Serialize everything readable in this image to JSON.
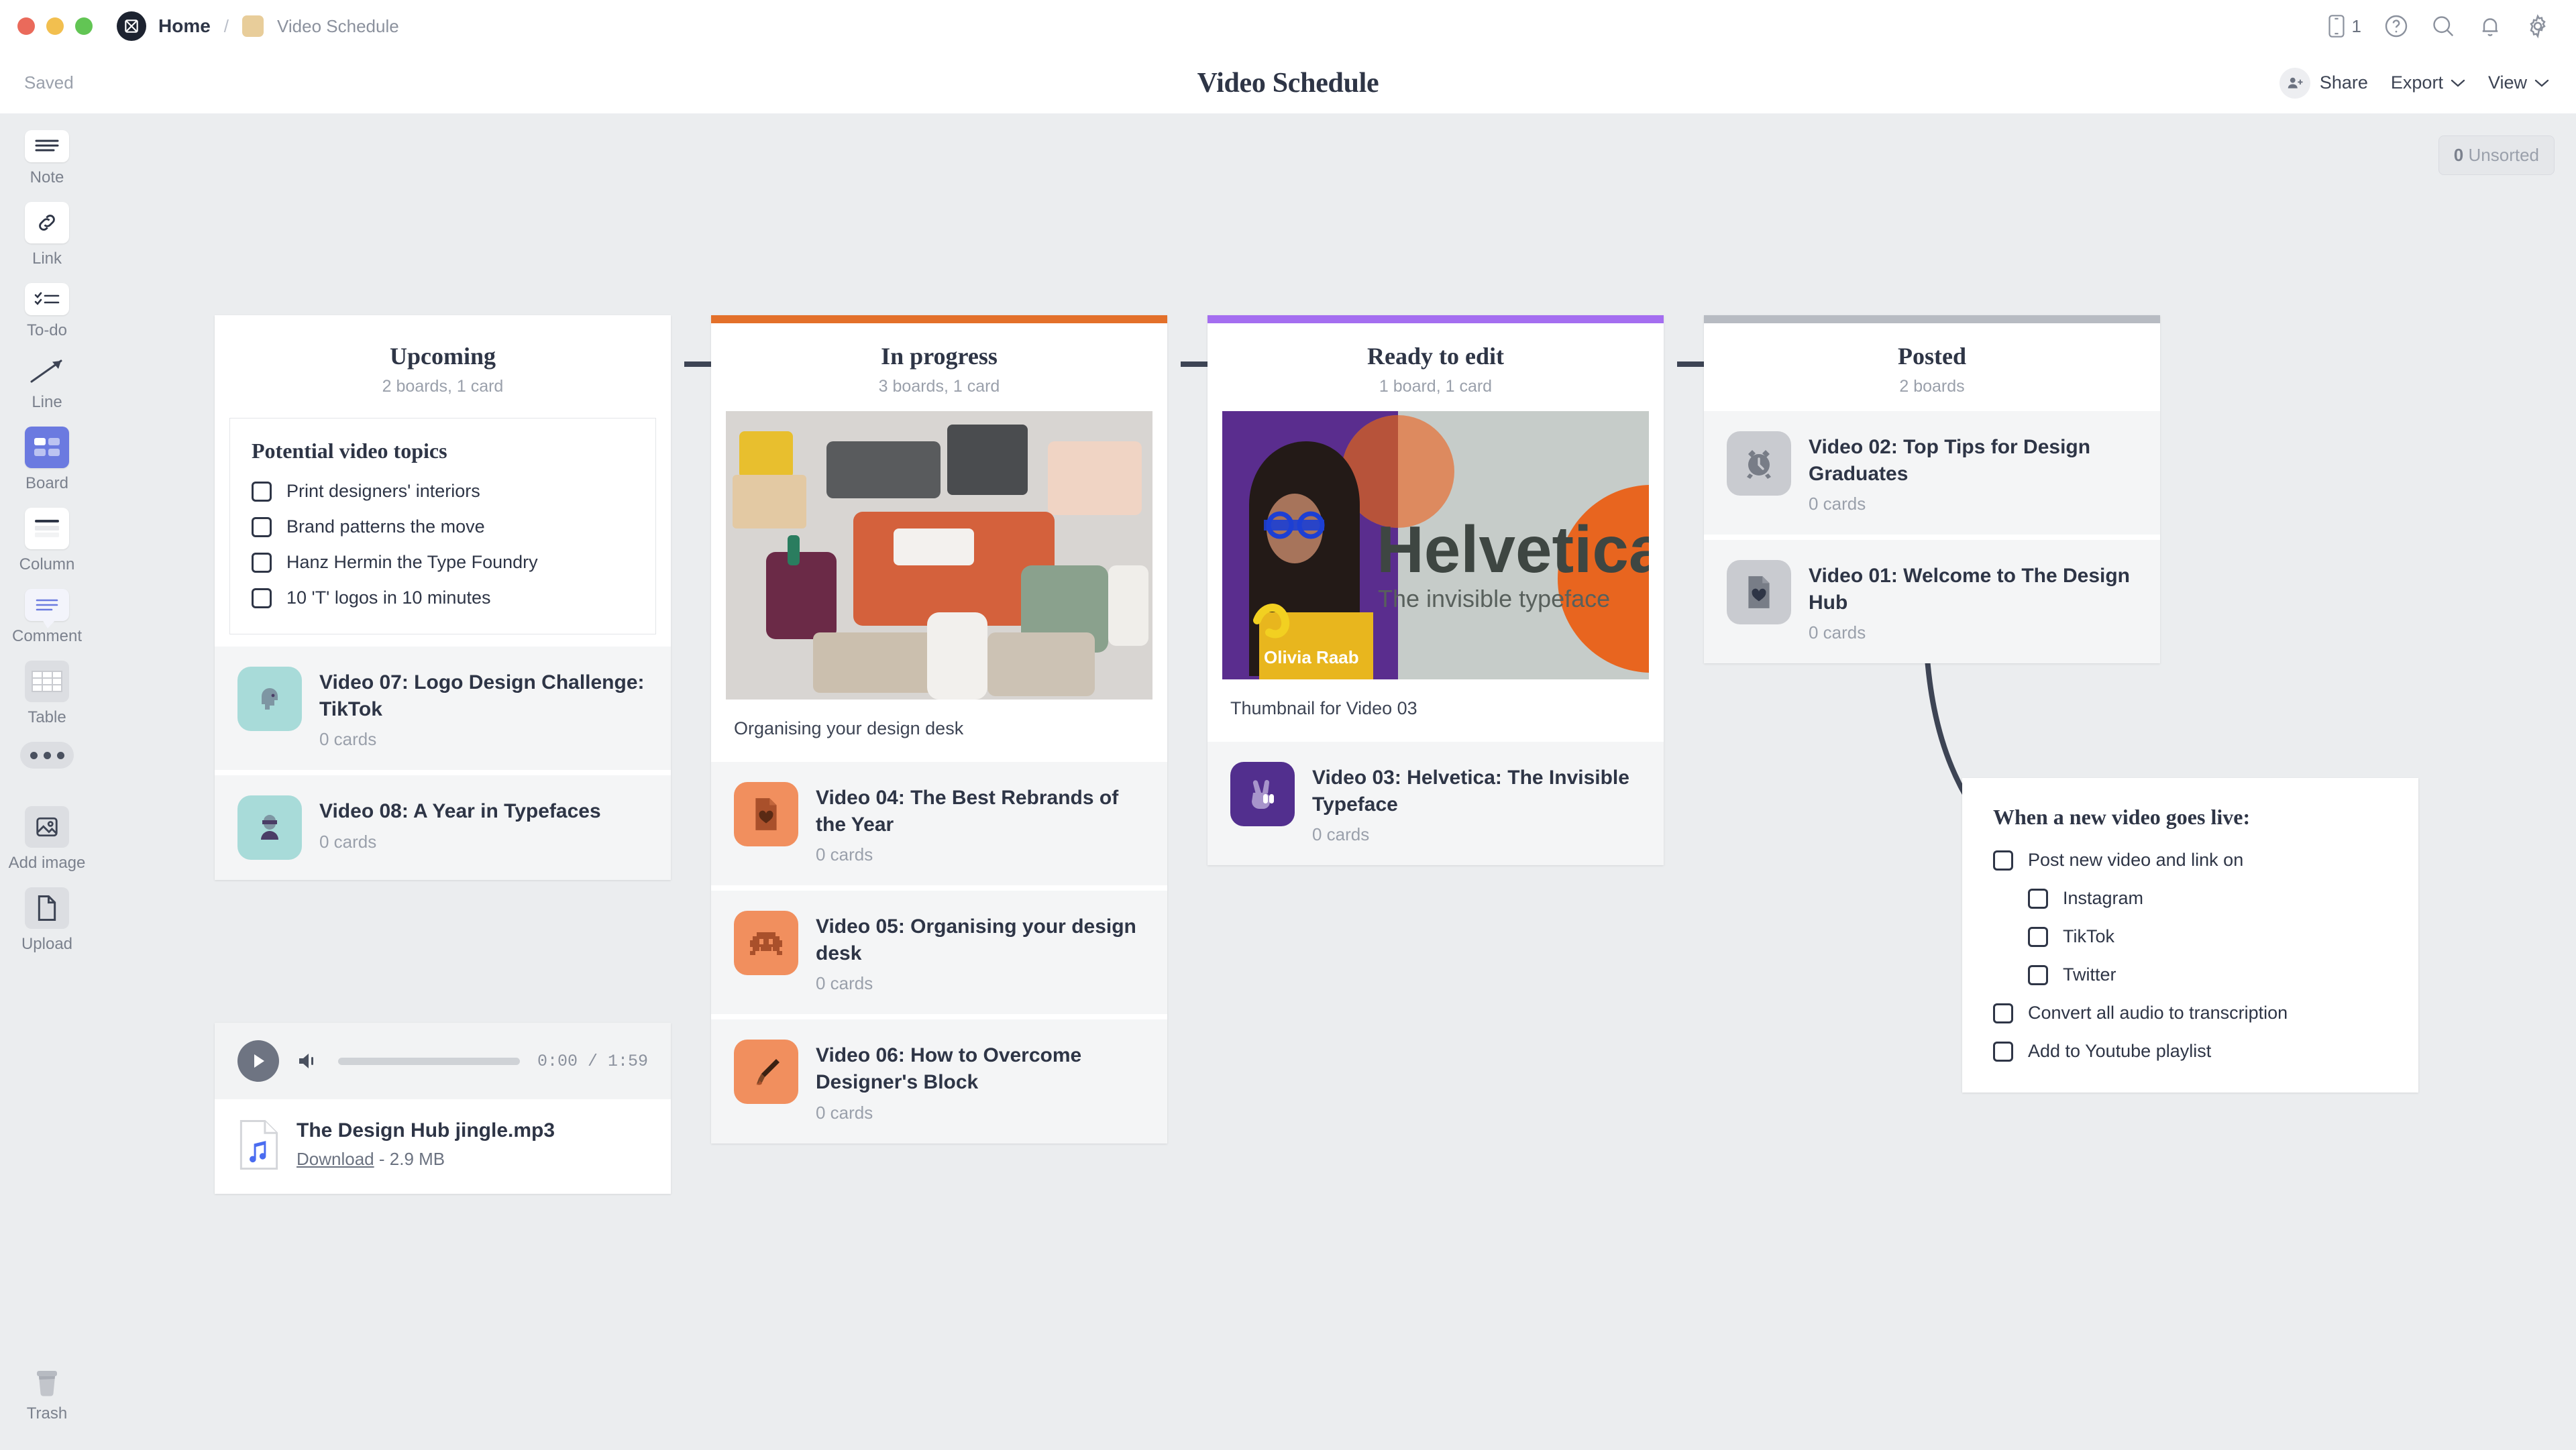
{
  "titlebar": {
    "breadcrumb_home": "Home",
    "breadcrumb_sep": "/",
    "breadcrumb_current": "Video Schedule",
    "mobile_count": "1",
    "icons": [
      "mobile-icon",
      "help-icon",
      "search-icon",
      "bell-icon",
      "gear-icon"
    ]
  },
  "header": {
    "saved_label": "Saved",
    "title": "Video Schedule",
    "share_label": "Share",
    "export_label": "Export",
    "view_label": "View",
    "chevron": "⌄"
  },
  "sidebar": {
    "items": [
      {
        "label": "Note",
        "icon": "note-icon"
      },
      {
        "label": "Link",
        "icon": "link-icon"
      },
      {
        "label": "To-do",
        "icon": "todo-icon"
      },
      {
        "label": "Line",
        "icon": "line-icon"
      },
      {
        "label": "Board",
        "icon": "board-icon"
      },
      {
        "label": "Column",
        "icon": "column-icon"
      },
      {
        "label": "Comment",
        "icon": "comment-icon"
      },
      {
        "label": "Table",
        "icon": "table-icon"
      }
    ],
    "more_label": "more-options",
    "add_image": {
      "label": "Add image",
      "icon": "image-icon"
    },
    "upload": {
      "label": "Upload",
      "icon": "document-icon"
    },
    "trash": {
      "label": "Trash",
      "icon": "trash-icon"
    }
  },
  "canvas": {
    "unsorted_count": "0",
    "unsorted_label": "Unsorted"
  },
  "colors": {
    "accent_orange": "#e3702a",
    "accent_purple": "#a46ef0",
    "accent_grey": "#b7bbc2",
    "board_active": "#6b7ae0"
  },
  "columns": [
    {
      "name": "upcoming",
      "title": "Upcoming",
      "subtitle": "2 boards, 1 card",
      "topbar_color": "transparent",
      "note": {
        "heading": "Potential video topics",
        "items": [
          "Print designers' interiors",
          "Brand patterns the move",
          "Hanz Hermin the Type Foundry",
          "10 'T' logos in 10 minutes"
        ]
      },
      "cards": [
        {
          "title": "Video 07: Logo Design Challenge: TikTok",
          "sub": "0 cards",
          "icon": "head-icon",
          "bg": "#a8dbd9",
          "fg": "#7e96a3"
        },
        {
          "title": "Video 08: A Year in Typefaces",
          "sub": "0 cards",
          "icon": "person-icon",
          "bg": "#a8dbd9",
          "fg": "#4a3d66"
        }
      ]
    },
    {
      "name": "in-progress",
      "title": "In progress",
      "subtitle": "3 boards, 1 card",
      "topbar_color": "#e3702a",
      "image_caption": "Organising your design desk",
      "cards": [
        {
          "title": "Video 04: The Best Rebrands of the Year",
          "sub": "0 cards",
          "icon": "heart-file-icon",
          "bg": "#f18f5e",
          "fg": "#a9502b"
        },
        {
          "title": "Video 05: Organising your design desk",
          "sub": "0 cards",
          "icon": "alien-icon",
          "bg": "#f18f5e",
          "fg": "#a9502b"
        },
        {
          "title": "Video 06: How to Overcome Designer's Block",
          "sub": "0 cards",
          "icon": "brush-icon",
          "bg": "#f18f5e",
          "fg": "#5a2a14"
        }
      ]
    },
    {
      "name": "ready-to-edit",
      "title": "Ready to edit",
      "subtitle": "1 board, 1 card",
      "topbar_color": "#a46ef0",
      "image_caption": "Thumbnail for Video 03",
      "thumbnail": {
        "headline": "Helvetica",
        "subhead": "The invisible typeface",
        "credit": "Olivia Raab"
      },
      "cards": [
        {
          "title": "Video 03: Helvetica: The Invisible Typeface",
          "sub": "0 cards",
          "icon": "peace-hand-icon",
          "bg": "#522f8e",
          "fg": "#a794cb"
        }
      ]
    },
    {
      "name": "posted",
      "title": "Posted",
      "subtitle": "2 boards",
      "topbar_color": "#b7bbc2",
      "cards": [
        {
          "title": "Video 02: Top Tips for Design Graduates",
          "sub": "0 cards",
          "icon": "alarm-clock-icon",
          "bg": "#c9cbd0",
          "fg": "#787d87"
        },
        {
          "title": "Video 01: Welcome to The Design Hub",
          "sub": "0 cards",
          "icon": "heart-file-icon",
          "bg": "#c9cbd0",
          "fg": "#787d87"
        }
      ]
    }
  ],
  "audio": {
    "current_time": "0:00",
    "duration": "1:59",
    "time_display": "0:00 / 1:59",
    "file_name": "The Design Hub jingle.mp3",
    "download_label": "Download",
    "separator": "-",
    "file_size": "2.9 MB"
  },
  "live_checklist": {
    "heading": "When a new video goes live:",
    "items": [
      {
        "label": "Post new video and link on",
        "indent": 0
      },
      {
        "label": "Instagram",
        "indent": 1
      },
      {
        "label": "TikTok",
        "indent": 1
      },
      {
        "label": "Twitter",
        "indent": 1
      },
      {
        "label": "Convert all audio to transcription",
        "indent": 0
      },
      {
        "label": "Add to Youtube playlist",
        "indent": 0
      }
    ]
  }
}
